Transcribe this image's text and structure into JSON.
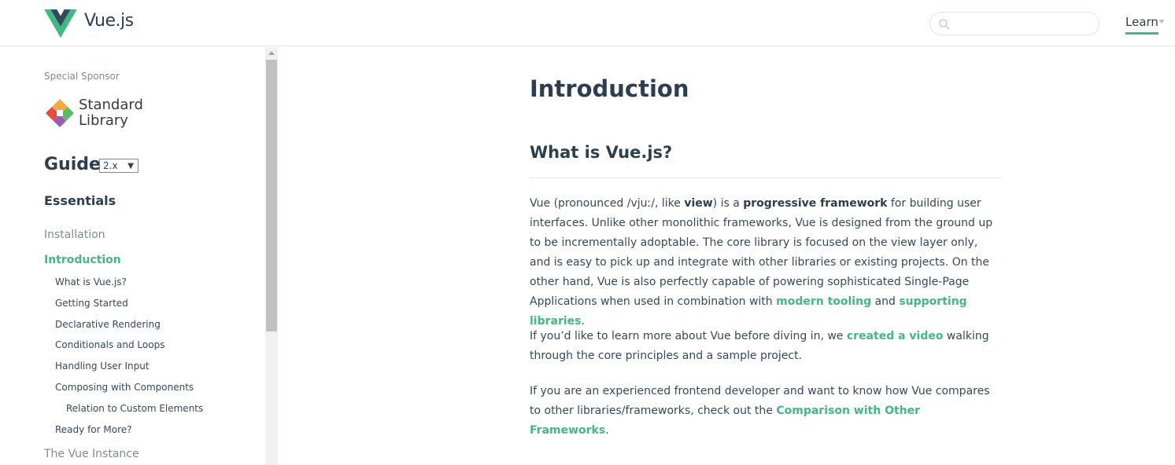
{
  "header": {
    "brand": "Vue.js",
    "search": {
      "value": "",
      "placeholder": ""
    },
    "nav": {
      "learn": "Learn"
    }
  },
  "sidebar": {
    "sponsor_label": "Special Sponsor",
    "sponsor_name_line1": "Standard",
    "sponsor_name_line2": "Library",
    "guide_title": "Guide",
    "version": "2.x",
    "section": "Essentials",
    "items": [
      {
        "label": "Installation"
      },
      {
        "label": "Introduction"
      },
      {
        "label": "What is Vue.js?"
      },
      {
        "label": "Getting Started"
      },
      {
        "label": "Declarative Rendering"
      },
      {
        "label": "Conditionals and Loops"
      },
      {
        "label": "Handling User Input"
      },
      {
        "label": "Composing with Components"
      },
      {
        "label": "Relation to Custom Elements"
      },
      {
        "label": "Ready for More?"
      },
      {
        "label": "The Vue Instance"
      }
    ]
  },
  "content": {
    "title": "Introduction",
    "section_title": "What is Vue.js?",
    "p1": {
      "t1": "Vue (pronounced /vjuː/, like ",
      "b1": "view",
      "t2": ") is a ",
      "b2": "progressive framework",
      "t3": " for building user interfaces. Unlike other monolithic frameworks, Vue is designed from the ground up to be incrementally adoptable. The core library is focused on the view layer only, and is easy to pick up and integrate with other libraries or existing projects. On the other hand, Vue is also perfectly capable of powering sophisticated Single-Page Applications when used in combination with ",
      "link1": "modern tooling",
      "t4": " and ",
      "link2": "supporting libraries",
      "t5": "."
    },
    "p2": {
      "t1": "If you’d like to learn more about Vue before diving in, we ",
      "link1": "created a video",
      "t2": " walking through the core principles and a sample project."
    },
    "p3": {
      "t1": "If you are an experienced frontend developer and want to know how Vue compares to other libraries/frameworks, check out the ",
      "link1": "Comparison with Other Frameworks",
      "t2": "."
    }
  },
  "colors": {
    "accent": "#42b983",
    "text": "#34495e",
    "heading": "#2c3e50",
    "muted": "#7f8c8d"
  }
}
